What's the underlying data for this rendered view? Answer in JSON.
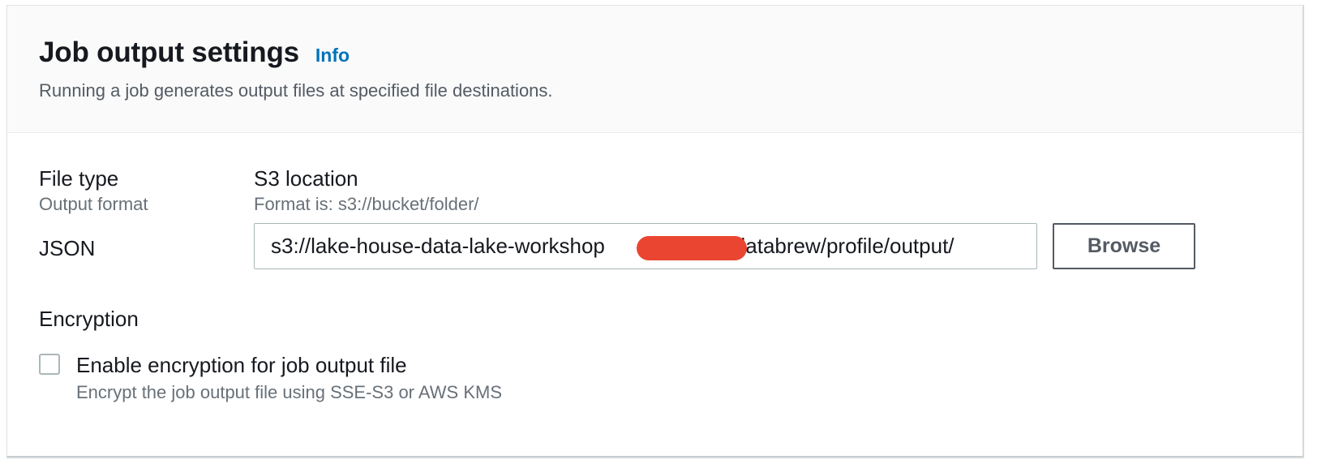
{
  "header": {
    "title": "Job output settings",
    "info_link": "Info",
    "description": "Running a job generates output files at specified file destinations."
  },
  "file_type": {
    "label": "File type",
    "sublabel": "Output format",
    "value": "JSON"
  },
  "s3_location": {
    "label": "S3 location",
    "sublabel": "Format is: s3://bucket/folder/",
    "value": "s3://lake-house-data-lake-workshop                     /databrew/profile/output/"
  },
  "browse_button": {
    "label": "Browse"
  },
  "encryption": {
    "heading": "Encryption",
    "checkbox_label": "Enable encryption for job output file",
    "checkbox_description": "Encrypt the job output file using SSE-S3 or AWS KMS",
    "checked": false
  },
  "colors": {
    "link": "#0073bb",
    "redaction": "#ea4530"
  }
}
